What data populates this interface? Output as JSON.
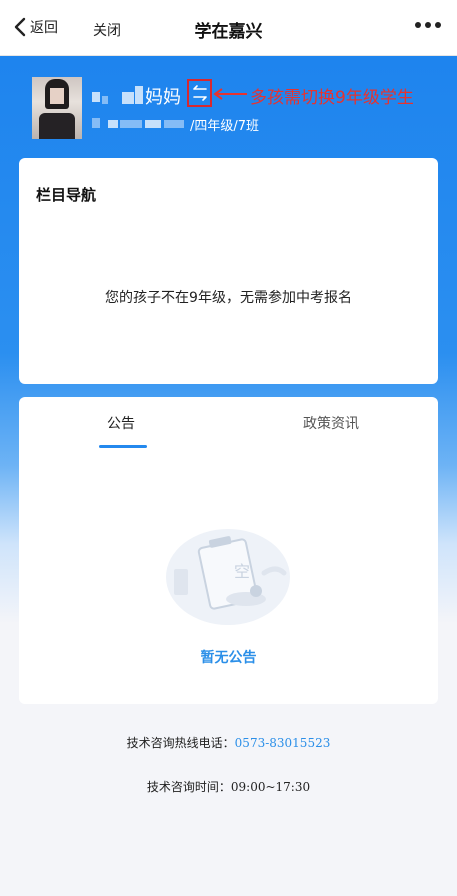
{
  "nav": {
    "back_label": "返回",
    "close_label": "关闭",
    "title": "学在嘉兴"
  },
  "profile": {
    "name_suffix": "妈妈",
    "grade_class": "/四年级/7班"
  },
  "annotation": {
    "text": "多孩需切换9年级学生",
    "color": "#e7332f"
  },
  "section_nav": {
    "title": "栏目导航",
    "message": "您的孩子不在9年级，无需参加中考报名"
  },
  "tabs": [
    {
      "label": "公告",
      "active": true
    },
    {
      "label": "政策资讯",
      "active": false
    }
  ],
  "empty_state": {
    "text": "暂无公告",
    "illus_text": "空"
  },
  "contact": {
    "hotline_label": "技术咨询热线电话：",
    "hotline_number": "0573-83015523",
    "hours_label": "技术咨询时间：",
    "hours_value": "09:00~17:30"
  },
  "colors": {
    "primary": "#1e84ee",
    "link": "#2b8fe8",
    "annotation": "#e7332f"
  }
}
